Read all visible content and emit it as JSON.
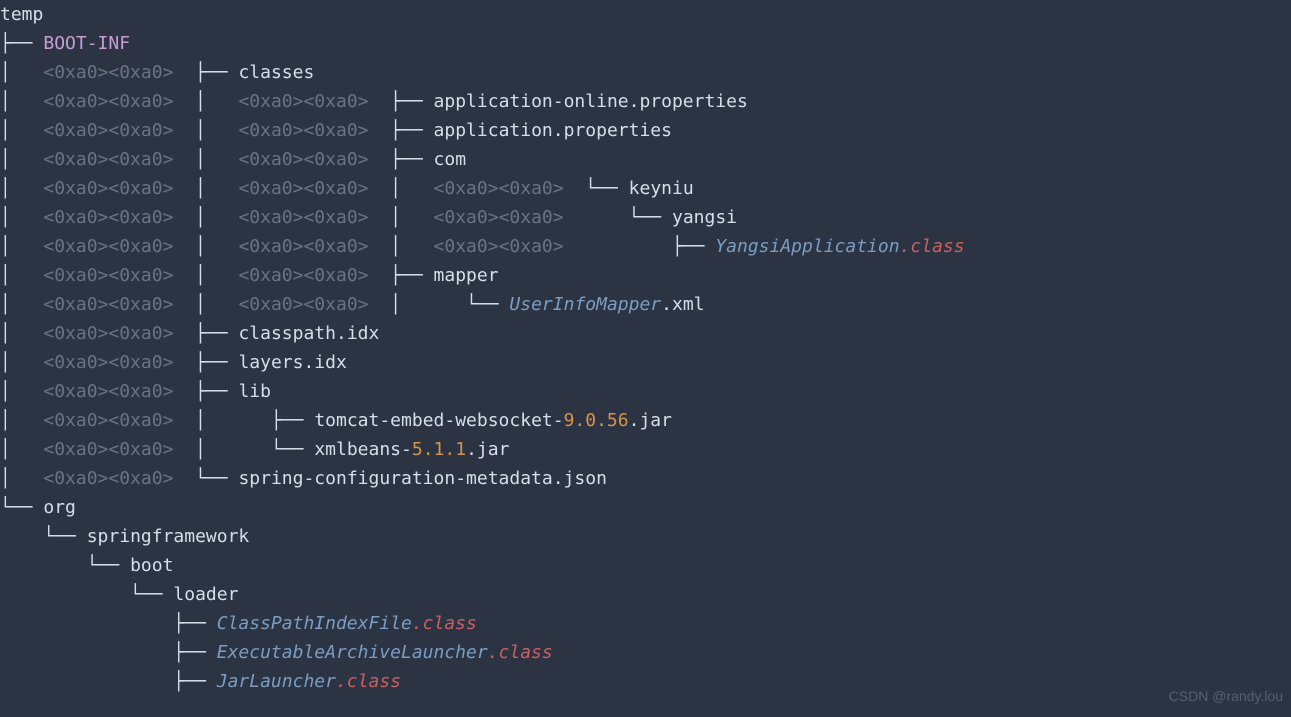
{
  "root": "temp",
  "bootinf": "BOOT-INF",
  "pad": "<0xa0><0xa0>",
  "tree": {
    "vbar": "│   ",
    "tee": "├── ",
    "end": "└── ",
    "space": "    "
  },
  "files": {
    "classes": "classes",
    "app_online": "application-online.properties",
    "app_props": "application.properties",
    "com": "com",
    "keyniu": "keyniu",
    "yangsi": "yangsi",
    "yangsi_app": "YangsiApplication",
    "class_ext": ".class",
    "mapper": "mapper",
    "userinfo": "UserInfoMapper",
    "xml_ext": ".xml",
    "classpath_idx": "classpath.idx",
    "layers_idx": "layers.idx",
    "lib": "lib",
    "tomcat_pre": "tomcat-embed-websocket-",
    "tomcat_ver": "9.0.56",
    "jar_ext": ".jar",
    "xmlbeans_pre": "xmlbeans-",
    "xmlbeans_ver": "5.1.1",
    "spring_cfg": "spring-configuration-metadata.json",
    "org": "org",
    "springfw": "springframework",
    "boot": "boot",
    "loader": "loader",
    "cpif": "ClassPathIndexFile",
    "eal": "ExecutableArchiveLauncher",
    "jl": "JarLauncher"
  },
  "watermark": "CSDN @randy.lou"
}
